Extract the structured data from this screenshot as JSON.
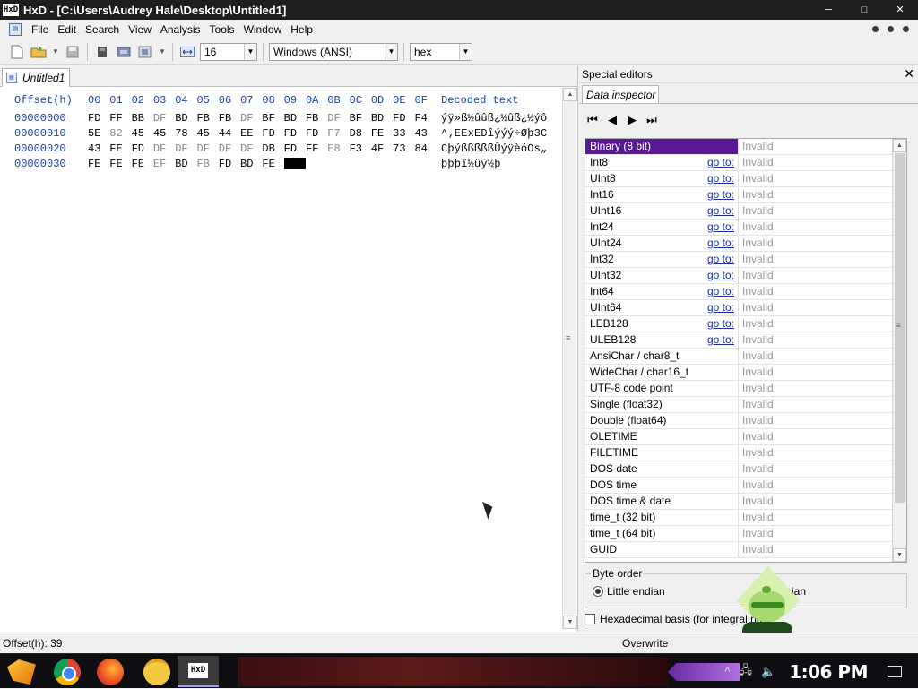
{
  "window": {
    "app_icon": "HxD",
    "title": "HxD - [C:\\Users\\Audrey Hale\\Desktop\\Untitled1]",
    "minimize": "─",
    "maximize": "□",
    "close": "✕"
  },
  "menu": {
    "items": [
      "File",
      "Edit",
      "Search",
      "View",
      "Analysis",
      "Tools",
      "Window",
      "Help"
    ]
  },
  "toolbar": {
    "bytes_per_row": "16",
    "charset": "Windows (ANSI)",
    "offset_base": "hex"
  },
  "editor": {
    "tab_label": "Untitled1",
    "header": {
      "offset": "Offset(h)",
      "columns": [
        "00",
        "01",
        "02",
        "03",
        "04",
        "05",
        "06",
        "07",
        "08",
        "09",
        "0A",
        "0B",
        "0C",
        "0D",
        "0E",
        "0F"
      ],
      "decoded": "Decoded text"
    },
    "rows": [
      {
        "offset": "00000000",
        "bytes": [
          "FD",
          "FF",
          "BB",
          "DF",
          "BD",
          "FB",
          "FB",
          "DF",
          "BF",
          "BD",
          "FB",
          "DF",
          "BF",
          "BD",
          "FD",
          "F4"
        ],
        "decoded": "ýÿ»ß½ûûß¿½ûß¿½ýô"
      },
      {
        "offset": "00000010",
        "bytes": [
          "5E",
          "82",
          "45",
          "45",
          "78",
          "45",
          "44",
          "EE",
          "FD",
          "FD",
          "FD",
          "F7",
          "D8",
          "FE",
          "33",
          "43"
        ],
        "decoded": "^‚EExEDîýýý÷Øþ3C"
      },
      {
        "offset": "00000020",
        "bytes": [
          "43",
          "FE",
          "FD",
          "DF",
          "DF",
          "DF",
          "DF",
          "DF",
          "DB",
          "FD",
          "FF",
          "E8",
          "F3",
          "4F",
          "73",
          "84"
        ],
        "decoded": "CþýßßßßßÛýÿèóOs„"
      },
      {
        "offset": "00000030",
        "bytes": [
          "FE",
          "FE",
          "FE",
          "EF",
          "BD",
          "FB",
          "FD",
          "BD",
          "FE"
        ],
        "decoded": "þþþï½ûý½þ"
      }
    ]
  },
  "special_editors": {
    "title": "Special editors",
    "close": "✕",
    "tab": "Data inspector",
    "nav": [
      "⏮",
      "◀",
      "▶",
      "⏭"
    ],
    "goto_label": "go to:",
    "rows": [
      {
        "name": "Binary (8 bit)",
        "value": "Invalid",
        "goto": false
      },
      {
        "name": "Int8",
        "value": "Invalid",
        "goto": true
      },
      {
        "name": "UInt8",
        "value": "Invalid",
        "goto": true
      },
      {
        "name": "Int16",
        "value": "Invalid",
        "goto": true
      },
      {
        "name": "UInt16",
        "value": "Invalid",
        "goto": true
      },
      {
        "name": "Int24",
        "value": "Invalid",
        "goto": true
      },
      {
        "name": "UInt24",
        "value": "Invalid",
        "goto": true
      },
      {
        "name": "Int32",
        "value": "Invalid",
        "goto": true
      },
      {
        "name": "UInt32",
        "value": "Invalid",
        "goto": true
      },
      {
        "name": "Int64",
        "value": "Invalid",
        "goto": true
      },
      {
        "name": "UInt64",
        "value": "Invalid",
        "goto": true
      },
      {
        "name": "LEB128",
        "value": "Invalid",
        "goto": true
      },
      {
        "name": "ULEB128",
        "value": "Invalid",
        "goto": true
      },
      {
        "name": "AnsiChar / char8_t",
        "value": "Invalid",
        "goto": false
      },
      {
        "name": "WideChar / char16_t",
        "value": "Invalid",
        "goto": false
      },
      {
        "name": "UTF-8 code point",
        "value": "Invalid",
        "goto": false
      },
      {
        "name": "Single (float32)",
        "value": "Invalid",
        "goto": false
      },
      {
        "name": "Double (float64)",
        "value": "Invalid",
        "goto": false
      },
      {
        "name": "OLETIME",
        "value": "Invalid",
        "goto": false
      },
      {
        "name": "FILETIME",
        "value": "Invalid",
        "goto": false
      },
      {
        "name": "DOS date",
        "value": "Invalid",
        "goto": false
      },
      {
        "name": "DOS time",
        "value": "Invalid",
        "goto": false
      },
      {
        "name": "DOS time & date",
        "value": "Invalid",
        "goto": false
      },
      {
        "name": "time_t (32 bit)",
        "value": "Invalid",
        "goto": false
      },
      {
        "name": "time_t (64 bit)",
        "value": "Invalid",
        "goto": false
      },
      {
        "name": "GUID",
        "value": "Invalid",
        "goto": false
      }
    ],
    "byte_order": {
      "legend": "Byte order",
      "little": "Little endian",
      "big_fragment": "ian"
    },
    "hex_basis": "Hexadecimal basis (for integral nu"
  },
  "status": {
    "offset": "Offset(h): 39",
    "mode": "Overwrite"
  },
  "taskbar": {
    "hxd_icon": "HxD",
    "clock": "1:06 PM"
  }
}
